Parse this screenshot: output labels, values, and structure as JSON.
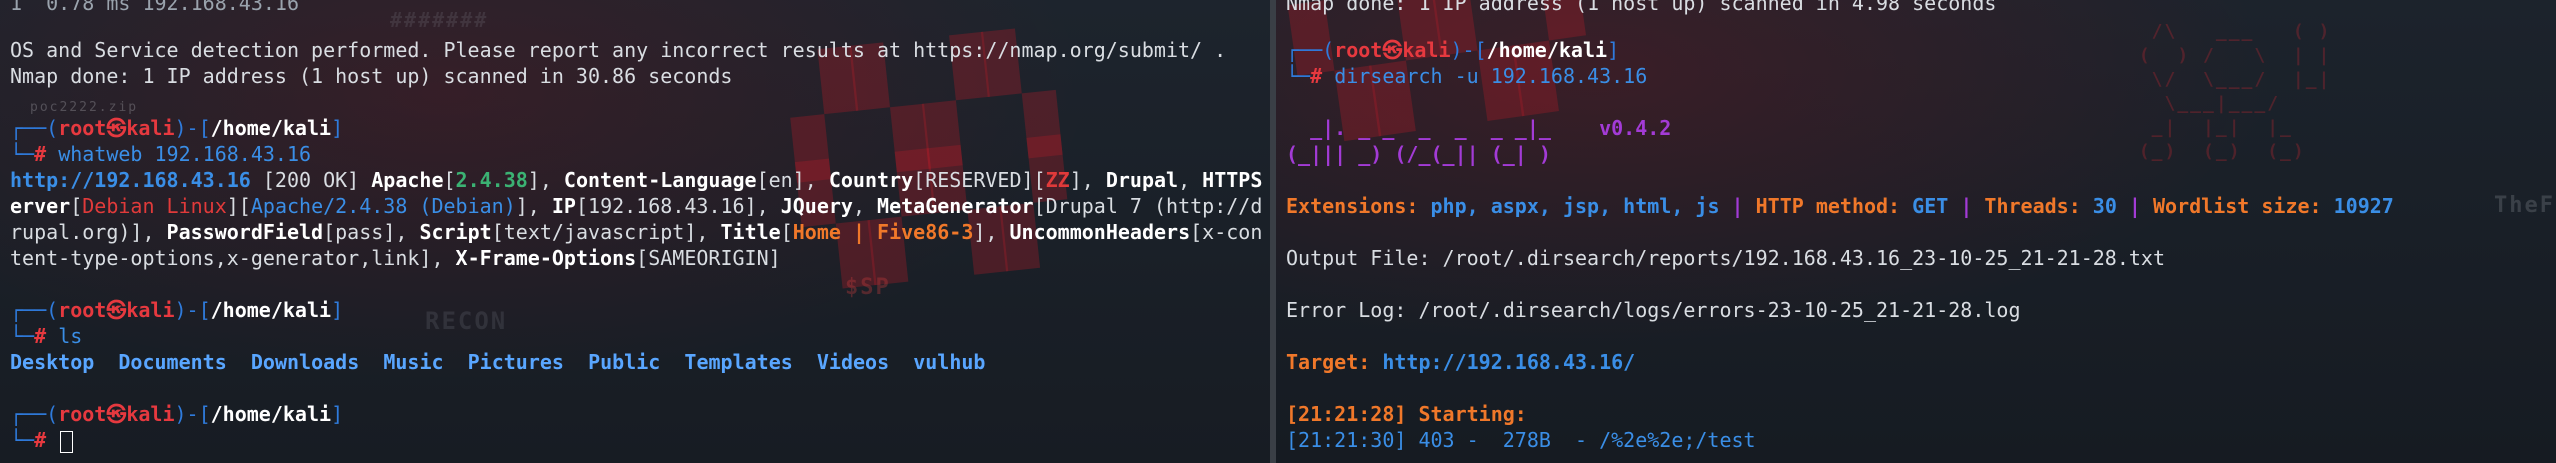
{
  "left": {
    "l0": "1  0.78 ms 192.168.43.16",
    "l1": "OS and Service detection performed. Please report any incorrect results at https://nmap.org/submit/ .",
    "l2": "Nmap done: 1 IP address (1 host up) scanned in 30.86 seconds",
    "prompt": {
      "user": "root",
      "at": "㉿",
      "host": "kali",
      "path": "/home/kali"
    },
    "cmd1": "whatweb 192.168.43.16",
    "whatweb": {
      "url": "http://192.168.43.16",
      "status": " [200 OK] ",
      "apache": "Apache",
      "apache_ver": "2.4.38",
      "cl": "Content-Language",
      "cl_val": "en",
      "country": "Country",
      "country_val": "RESERVED",
      "country_code": "ZZ",
      "drupal": "Drupal",
      "https_a": "HTTPS",
      "https_b": "erver",
      "https_val": "Debian Linux",
      "httpserver": "Apache/2.4.38 (Debian)",
      "ip": "IP",
      "ip_val": "192.168.43.16",
      "jquery": "JQuery",
      "metagen": "MetaGenerator",
      "metagen_val_a": "Drupal 7 (http://d",
      "metagen_val_b": "rupal.org)",
      "pwfield": "PasswordField",
      "pw_val": "pass",
      "script": "Script",
      "script_val": "text/javascript",
      "title": "Title",
      "title_val": "Home | Five86-3",
      "uh": "UncommonHeaders",
      "uh_val_a": "x-con",
      "uh_val_b": "tent-type-options,x-generator,link",
      "xfo": "X-Frame-Options",
      "xfo_val": "SAMEORIGIN"
    },
    "cmd2": "ls",
    "dirs": [
      "Desktop",
      "Documents",
      "Downloads",
      "Music",
      "Pictures",
      "Public",
      "Templates",
      "Videos",
      "vulhub"
    ],
    "wallpaper": {
      "recon": "RECON",
      "file": "poc2222.zip",
      "sp": "$SP"
    }
  },
  "right": {
    "l0": "Nmap done: 1 IP address (1 host up) scanned in 4.98 seconds",
    "cmd": "dirsearch -u 192.168.43.16",
    "logo1": "  _|. _ _  _  _  _ _|_    v0.4.2",
    "logo2": "(_||| _) (/_(_|| (_| )",
    "ext_label": "Extensions: ",
    "ext_val": "php, aspx, jsp, html, js",
    "sep": " | ",
    "method_label": "HTTP method: ",
    "method_val": "GET",
    "threads_label": "Threads: ",
    "threads_val": "30",
    "wl_label": "Wordlist size: ",
    "wl_val": "10927",
    "output": "Output File: /root/.dirsearch/reports/192.168.43.16_23-10-25_21-21-28.txt",
    "errorlog": "Error Log: /root/.dirsearch/logs/errors-23-10-25_21-21-28.log",
    "target_label": "Target: ",
    "target_val": "http://192.168.43.16/",
    "start_time": "[21:21:28] Starting:",
    "last_line": "[21:21:30] 403 -  278B  - /%2e%2e;/test",
    "wallpaper_text": "TheFa"
  }
}
